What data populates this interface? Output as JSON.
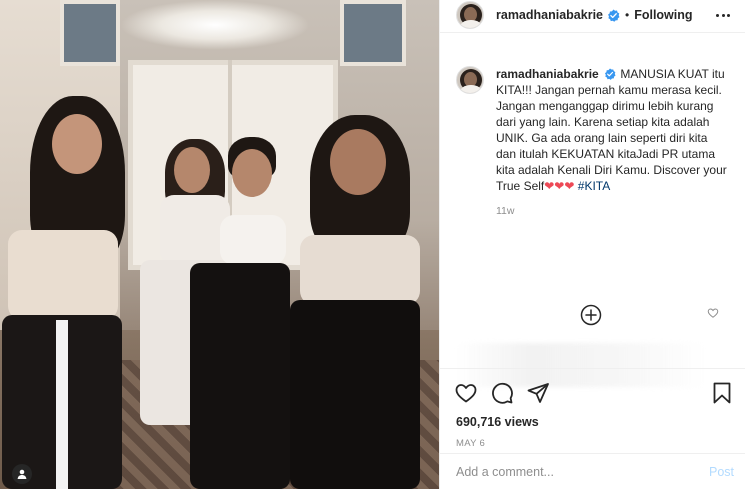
{
  "post": {
    "username": "ramadhaniabakrie",
    "separator": "•",
    "follow_status": "Following"
  },
  "caption": {
    "username": "ramadhaniabakrie",
    "text": " MANUSIA KUAT itu KITA!!! Jangan pernah kamu merasa kecil. Jangan menganggap dirimu lebih kurang dari yang lain. Karena setiap kita adalah UNIK. Ga ada orang lain seperti diri kita dan itulah KEKUATAN kitaJadi PR utama kita adalah Kenali Diri Kamu. Discover your True Self",
    "hearts": "❤❤❤",
    "hashtag": "#KITA",
    "time_ago": "11w"
  },
  "stats": {
    "likes": "690,716 views",
    "date": "MAY 6"
  },
  "comment_box": {
    "placeholder": "Add a comment...",
    "post_label": "Post"
  },
  "icons": {
    "verified": "verified-badge-icon",
    "more": "more-options-icon",
    "load_more": "plus-circle-icon",
    "like": "heart-icon",
    "comment": "comment-icon",
    "share": "paper-plane-icon",
    "save": "bookmark-icon",
    "user_tag": "user-tag-icon"
  },
  "colors": {
    "verified": "#3897f0",
    "hashtag": "#00376b",
    "hearts": "#ed4956",
    "muted": "#8e8e8e",
    "post_button": "#b3dbff"
  }
}
